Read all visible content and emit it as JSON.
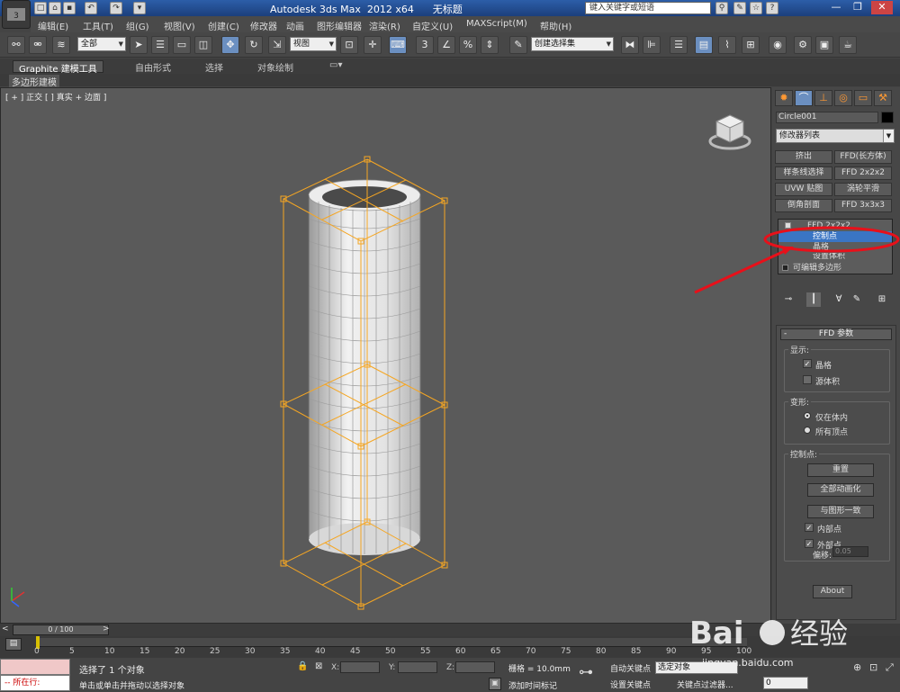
{
  "titlebar": {
    "app_title": "Autodesk 3ds Max  2012 x64      无标题",
    "search_placeholder": "键入关键字或短语",
    "window_buttons": [
      "—",
      "❐",
      "✕"
    ]
  },
  "menu": {
    "items": [
      "编辑(E)",
      "工具(T)",
      "组(G)",
      "视图(V)",
      "创建(C)",
      "修改器",
      "动画",
      "图形编辑器",
      "渲染(R)",
      "自定义(U)",
      "MAXScript(M)",
      "帮助(H)"
    ]
  },
  "toolbar": {
    "selection_filter": "全部",
    "reference_coord": "视图",
    "named_selection": "创建选择集"
  },
  "ribbon": {
    "tabs": [
      "Graphite 建模工具",
      "自由形式",
      "选择",
      "对象绘制"
    ],
    "sub_label": "多边形建模"
  },
  "viewport": {
    "label": "[ + ] 正交 [ ] 真实 + 边面 ]"
  },
  "command_panel": {
    "object_name": "Circle001",
    "modifier_list": "修改器列表",
    "modifier_buttons": [
      "挤出",
      "FFD(长方体)",
      "样条线选择",
      "FFD 2x2x2",
      "UVW 贴图",
      "涡轮平滑",
      "倒角剖面",
      "FFD 3x3x3"
    ],
    "stack": {
      "top": "FFD 2x2x2",
      "sub_items": [
        "控制点",
        "晶格",
        "设置体积"
      ],
      "base": "可编辑多边形"
    },
    "rollout_title": "FFD 参数",
    "display_group": {
      "label": "显示:",
      "options": [
        {
          "label": "晶格",
          "checked": true
        },
        {
          "label": "源体积",
          "checked": false
        }
      ]
    },
    "deform_group": {
      "label": "变形:",
      "options": [
        {
          "label": "仅在体内",
          "selected": true
        },
        {
          "label": "所有顶点",
          "selected": false
        }
      ]
    },
    "control_group": {
      "label": "控制点:",
      "buttons": [
        "重置",
        "全部动画化",
        "与图形一致"
      ],
      "checks": [
        {
          "label": "内部点",
          "checked": true
        },
        {
          "label": "外部点",
          "checked": true
        }
      ],
      "offset_label": "偏移:",
      "offset_value": "0.05"
    },
    "about_button": "About"
  },
  "timeline": {
    "slider_text": "0 / 100",
    "ticks": [
      "0",
      "5",
      "10",
      "15",
      "20",
      "25",
      "30",
      "35",
      "40",
      "45",
      "50",
      "55",
      "60",
      "65",
      "70",
      "75",
      "80",
      "85",
      "90",
      "95",
      "100"
    ]
  },
  "status": {
    "script_label": "所在行:",
    "selection_msg": "选择了 1 个对象",
    "hint_msg": "单击或单击并拖动以选择对象",
    "x_label": "X:",
    "y_label": "Y:",
    "z_label": "Z:",
    "grid": "栅格 = 10.0mm",
    "add_time_tag": "添加时间标记",
    "auto_key": "自动关键点",
    "set_key": "设置关键点",
    "selected_dd": "选定对象",
    "key_filters": "关键点过滤器...",
    "frame": "0"
  },
  "watermark": {
    "brand": "Baidu经验",
    "url": "jingyan.baidu.com"
  },
  "colors": {
    "accent_orange": "#f5a623",
    "selection_blue": "#3a75c4",
    "annotation_red": "#e8101a"
  }
}
